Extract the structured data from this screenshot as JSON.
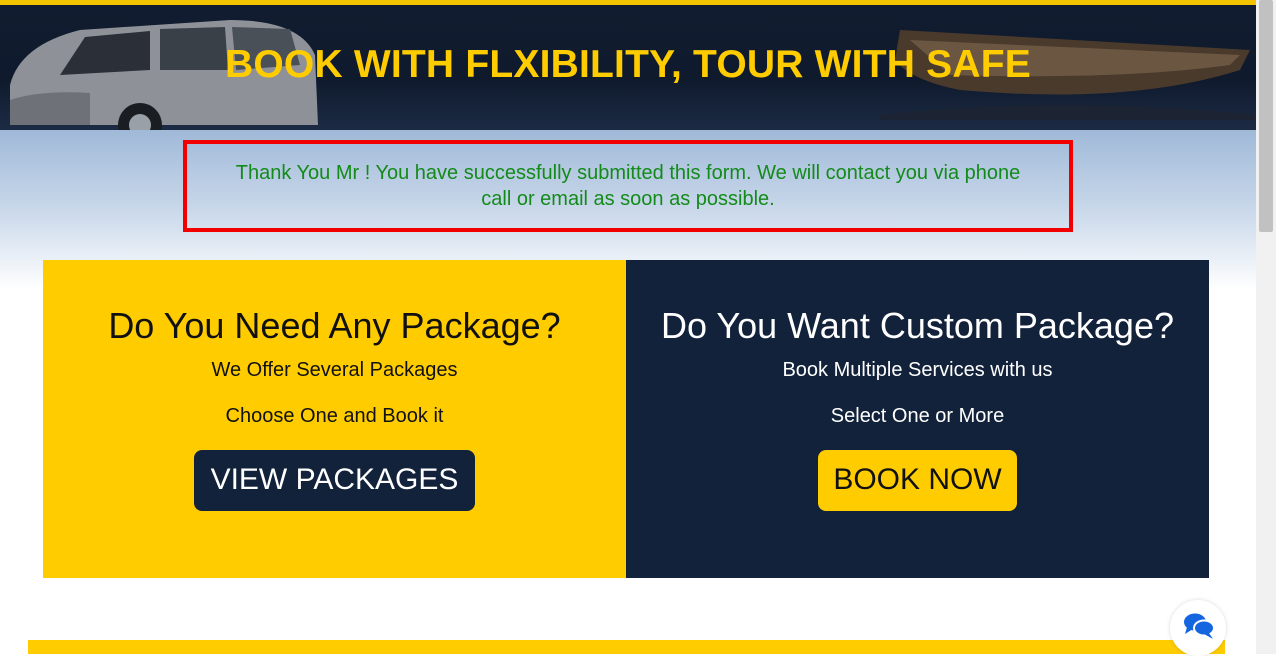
{
  "hero": {
    "title": "BOOK WITH FLXIBILITY, TOUR WITH SAFE"
  },
  "notice": {
    "message": "Thank You Mr ! You have successfully submitted this form. We will contact you via phone call or email as soon as possible."
  },
  "packages": {
    "heading": "Do You Need Any Package?",
    "line1": "We Offer Several Packages",
    "line2": "Choose One and Book it",
    "button_label": "VIEW PACKAGES"
  },
  "custom": {
    "heading": "Do You Want Custom Package?",
    "line1": "Book Multiple Services with us",
    "line2": "Select One or More",
    "button_label": "BOOK NOW"
  },
  "chat": {
    "icon": "chat-bubbles-icon"
  },
  "colors": {
    "accent_yellow": "#ffcc00",
    "navy": "#12223b",
    "success_green": "#138a1a",
    "alert_red": "#f20000"
  }
}
